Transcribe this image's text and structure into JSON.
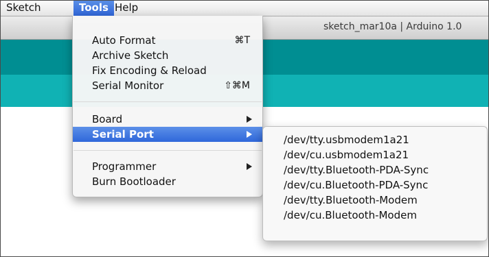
{
  "menubar": {
    "items": [
      "Sketch",
      "Tools",
      "Help"
    ]
  },
  "window": {
    "title": "sketch_mar10a | Arduino 1.0"
  },
  "tools_menu": {
    "items": [
      {
        "label": "Auto Format",
        "shortcut": "⌘T"
      },
      {
        "label": "Archive Sketch",
        "shortcut": ""
      },
      {
        "label": "Fix Encoding & Reload",
        "shortcut": ""
      },
      {
        "label": "Serial Monitor",
        "shortcut": "⇧⌘M"
      },
      {
        "label": "Board",
        "shortcut": ""
      },
      {
        "label": "Serial Port",
        "shortcut": ""
      },
      {
        "label": "Programmer",
        "shortcut": ""
      },
      {
        "label": "Burn Bootloader",
        "shortcut": ""
      }
    ]
  },
  "serial_port_submenu": {
    "items": [
      "/dev/tty.usbmodem1a21",
      "/dev/cu.usbmodem1a21",
      "/dev/tty.Bluetooth-PDA-Sync",
      "/dev/cu.Bluetooth-PDA-Sync",
      "/dev/tty.Bluetooth-Modem",
      "/dev/cu.Bluetooth-Modem"
    ]
  },
  "colors": {
    "toolbar": "#008e92",
    "tabs": "#10b2b4",
    "menu_highlight": "#3a73dd"
  },
  "icons": {
    "submenu_arrow": "triangle-right"
  }
}
